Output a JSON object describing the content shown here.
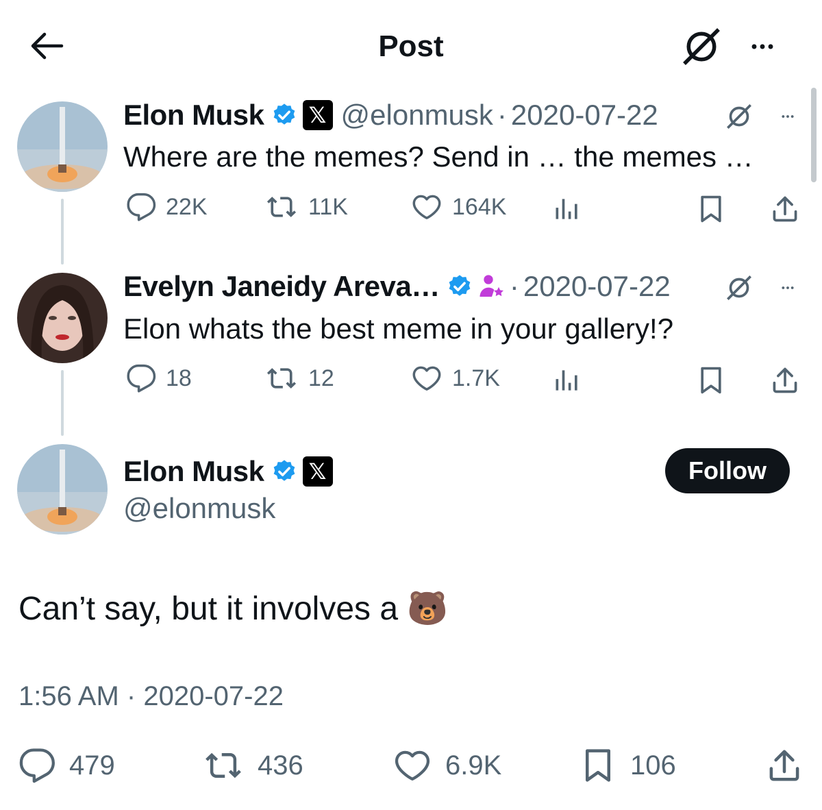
{
  "header": {
    "title": "Post",
    "back_icon": "arrow-left-icon",
    "grok_icon": "grok-icon",
    "more_icon": "more-horizontal-icon"
  },
  "colors": {
    "text": "#0f1419",
    "muted": "#536471",
    "verified": "#1d9bf0",
    "thread_line": "#cfd9de",
    "follow_bg": "#0f1419",
    "affiliate_badge": "#c13cd9"
  },
  "thread": [
    {
      "name": "Elon Musk",
      "handle": "@elonmusk",
      "separator": "·",
      "date": "2020-07-22",
      "text": "Where are the memes? Send in … the memes …",
      "stats": {
        "replies": "22K",
        "reposts": "11K",
        "likes": "164K"
      }
    },
    {
      "name": "Evelyn Janeidy Areva…",
      "separator": "·",
      "date": "2020-07-22",
      "text": "Elon whats the best meme in your gallery!?",
      "stats": {
        "replies": "18",
        "reposts": "12",
        "likes": "1.7K"
      }
    }
  ],
  "main_post": {
    "name": "Elon Musk",
    "handle": "@elonmusk",
    "follow_label": "Follow",
    "text": "Can’t say, but it involves a 🐻",
    "time": "1:56 AM",
    "separator": "·",
    "date": "2020-07-22",
    "stats": {
      "replies": "479",
      "reposts": "436",
      "likes": "6.9K",
      "bookmarks": "106"
    }
  }
}
